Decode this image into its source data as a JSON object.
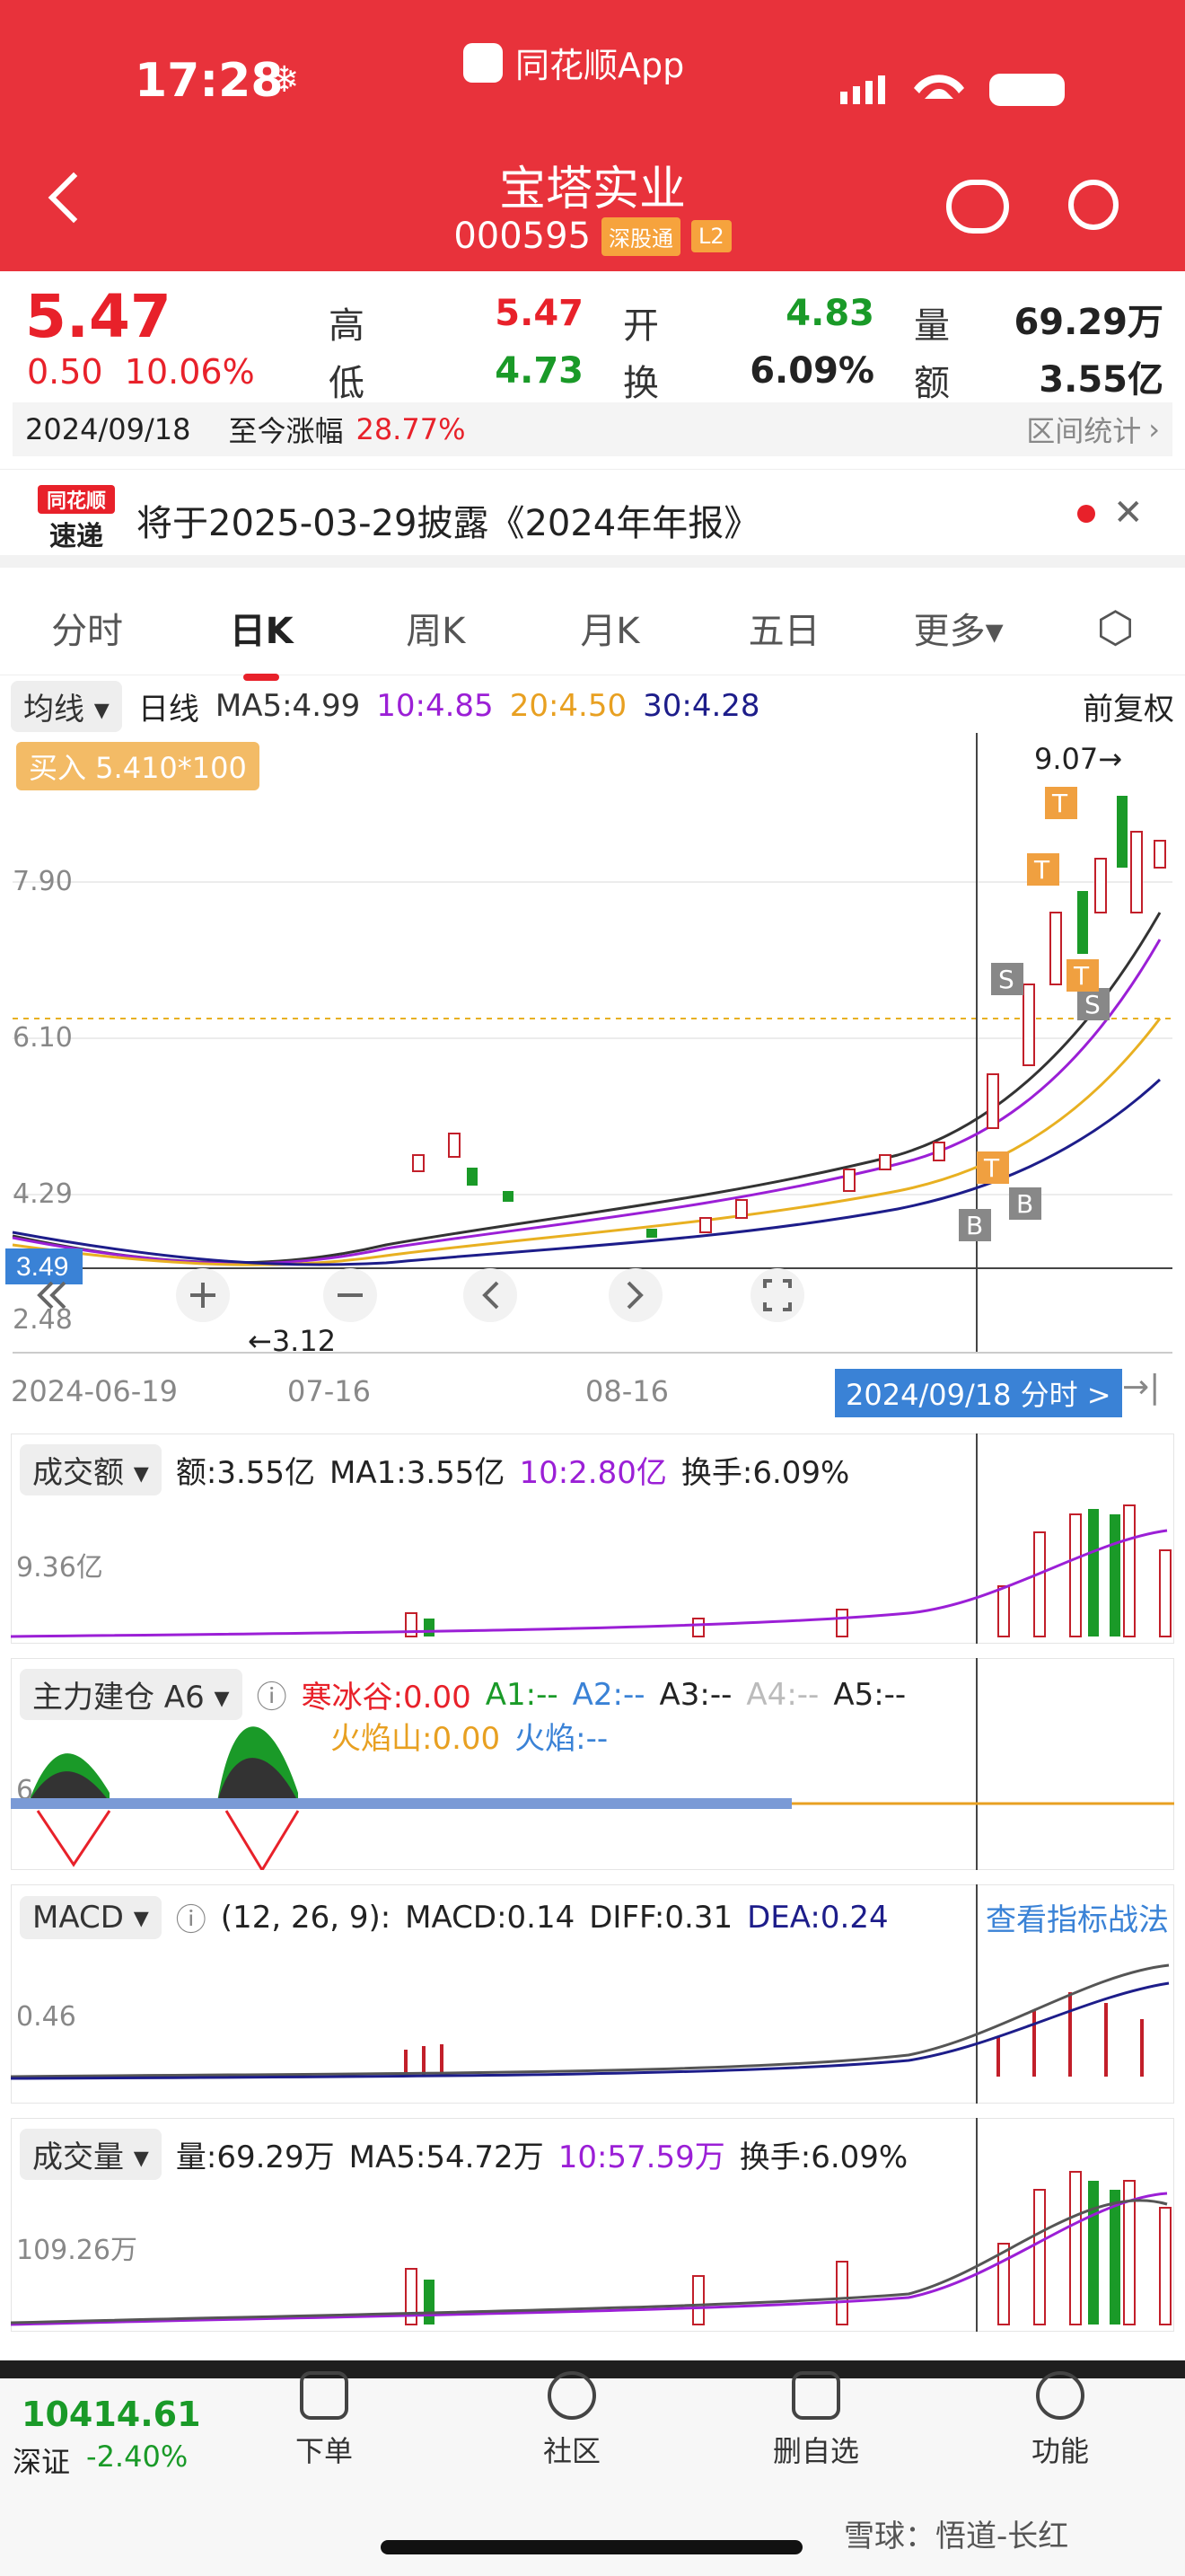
{
  "status": {
    "time": "17:28",
    "app": "同花顺App"
  },
  "stock": {
    "name": "宝塔实业",
    "code": "000595",
    "badge1": "深股通",
    "badge2": "L2"
  },
  "quote": {
    "price": "5.47",
    "change": "0.50",
    "change_pct": "10.06%",
    "high_label": "高",
    "high": "5.47",
    "open_label": "开",
    "open": "4.83",
    "vol_label": "量",
    "vol": "69.29万",
    "low_label": "低",
    "low": "4.73",
    "turn_label": "换",
    "turn": "6.09%",
    "amt_label": "额",
    "amt": "3.55亿",
    "date": "2024/09/18",
    "since_label": "至今涨幅",
    "since": "28.77%",
    "range_stat": "区间统计"
  },
  "notice": {
    "brand_top": "同花顺",
    "brand_bottom": "速递",
    "text": "将于2025-03-29披露《2024年年报》"
  },
  "tabs": [
    "分时",
    "日K",
    "周K",
    "月K",
    "五日",
    "更多▾"
  ],
  "ma": {
    "type": "均线",
    "period": "日线",
    "ma5": "MA5:4.99",
    "ma10": "10:4.85",
    "ma20": "20:4.50",
    "ma30": "30:4.28",
    "adj": "前复权"
  },
  "kline": {
    "buy_tag": "买入 5.410*100",
    "y_labels": [
      "7.90",
      "6.10",
      "4.29",
      "2.48"
    ],
    "current_price_tag": "3.49",
    "max_label": "9.07→",
    "min_label": "←3.12",
    "dates": [
      "2024-06-19",
      "07-16",
      "08-16"
    ],
    "date_cursor": "2024/09/18 分时 >",
    "tags": {
      "buy": "B",
      "sell": "S",
      "t": "T"
    }
  },
  "amount_panel": {
    "title": "成交额",
    "amt": "额:3.55亿",
    "ma1": "MA1:3.55亿",
    "ma10": "10:2.80亿",
    "turn": "换手:6.09%",
    "y_label": "9.36亿"
  },
  "fund_panel": {
    "title": "主力建仓 A6",
    "hbg": "寒冰谷:0.00",
    "a1": "A1:--",
    "a2": "A2:--",
    "a3": "A3:--",
    "a4": "A4:--",
    "a5": "A5:--",
    "hys": "火焰山:0.00",
    "hy": "火焰:--",
    "y_label": "6.5"
  },
  "macd_panel": {
    "title": "MACD",
    "params": "(12, 26, 9):",
    "macd": "MACD:0.14",
    "diff": "DIFF:0.31",
    "dea": "DEA:0.24",
    "link": "查看指标战法",
    "y_label": "0.46"
  },
  "volume_panel": {
    "title": "成交量",
    "vol": "量:69.29万",
    "ma5": "MA5:54.72万",
    "ma10": "10:57.59万",
    "turn": "换手:6.09%",
    "y_label": "109.26万"
  },
  "bottom_nav": {
    "index_value": "10414.61",
    "index_name": "深证",
    "index_change": "-2.40%",
    "items": [
      "下单",
      "社区",
      "删自选",
      "功能"
    ],
    "watermark": "雪球：悟道-长红"
  },
  "colors": {
    "red": "#e8212a",
    "green": "#1a9a28",
    "header": "#e8323b",
    "ma5": "#333333",
    "ma10": "#9b1fd6",
    "ma20": "#e8b021",
    "ma30": "#1d1d8a"
  }
}
